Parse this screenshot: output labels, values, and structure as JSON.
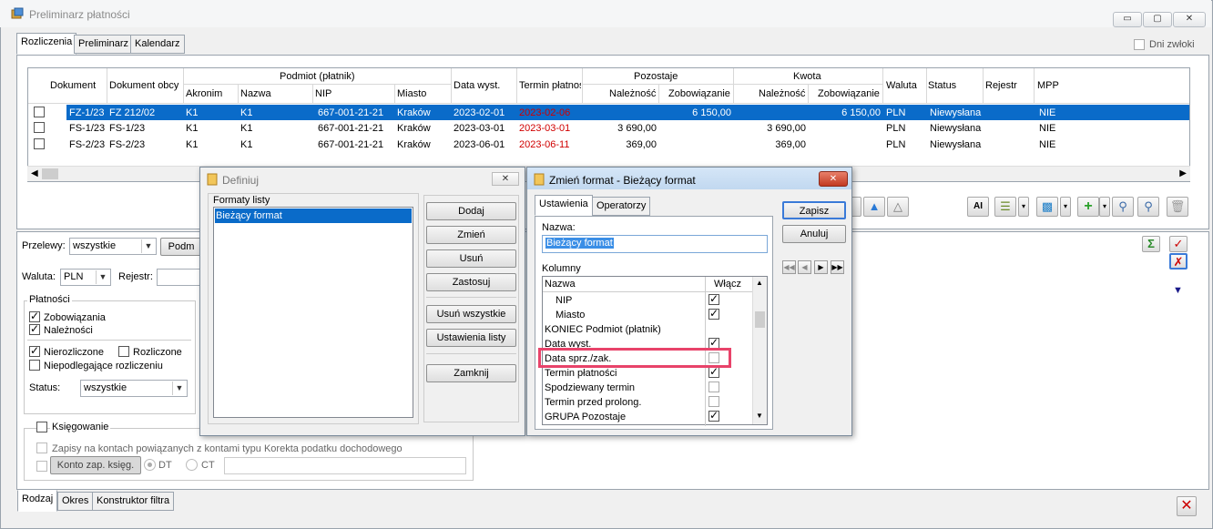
{
  "window": {
    "title": "Preliminarz płatności",
    "controls": {
      "minimize": "▭",
      "maximize": "▢",
      "close": "✕"
    }
  },
  "top_tabs": [
    "Rozliczenia",
    "Preliminarz",
    "Kalendarz"
  ],
  "dni_zwloki": "Dni zwłoki",
  "grid": {
    "headers": {
      "dokument": "Dokument",
      "dokument_obcy": "Dokument obcy",
      "podmiot_group": "Podmiot (płatnik)",
      "akronim": "Akronim",
      "nazwa": "Nazwa",
      "nip": "NIP",
      "miasto": "Miasto",
      "data_wyst": "Data wyst.",
      "termin": "Termin płatnoś",
      "pozostaje_group": "Pozostaje",
      "naleznosc": "Należność",
      "zobowiazanie": "Zobowiązanie",
      "kwota_group": "Kwota",
      "kwota_naleznosc": "Należność",
      "kwota_zobowiazanie": "Zobowiązanie",
      "waluta": "Waluta",
      "status": "Status",
      "rejestr": "Rejestr",
      "mpp": "MPP"
    },
    "rows": [
      {
        "dok": "FZ-1/23",
        "obcy": "FZ 212/02",
        "akr": "K1",
        "naz": "K1",
        "nip": "667-001-21-21",
        "miasto": "Kraków",
        "data": "2023-02-01",
        "termin": "2023-02-06",
        "p_nal": "",
        "p_zob": "6 150,00",
        "k_nal": "",
        "k_zob": "6 150,00",
        "waluta": "PLN",
        "status": "Niewysłana",
        "rejestr": "",
        "mpp": "NIE"
      },
      {
        "dok": "FS-1/23",
        "obcy": "FS-1/23",
        "akr": "K1",
        "naz": "K1",
        "nip": "667-001-21-21",
        "miasto": "Kraków",
        "data": "2023-03-01",
        "termin": "2023-03-01",
        "p_nal": "3 690,00",
        "p_zob": "",
        "k_nal": "3 690,00",
        "k_zob": "",
        "waluta": "PLN",
        "status": "Niewysłana",
        "rejestr": "",
        "mpp": "NIE"
      },
      {
        "dok": "FS-2/23",
        "obcy": "FS-2/23",
        "akr": "K1",
        "naz": "K1",
        "nip": "667-001-21-21",
        "miasto": "Kraków",
        "data": "2023-06-01",
        "termin": "2023-06-11",
        "p_nal": "369,00",
        "p_zob": "",
        "k_nal": "369,00",
        "k_zob": "",
        "waluta": "PLN",
        "status": "Niewysłana",
        "rejestr": "",
        "mpp": "NIE"
      }
    ]
  },
  "filters": {
    "przelewy_label": "Przelewy:",
    "przelewy_value": "wszystkie",
    "podm_button": "Podm",
    "waluta_label": "Waluta:",
    "waluta_value": "PLN",
    "rejestr_label": "Rejestr:",
    "platnosci_title": "Płatności",
    "zobowiazania": "Zobowiązania",
    "naleznosci": "Należności",
    "nierozliczone": "Nierozliczone",
    "rozliczone": "Rozliczone",
    "niepodlegajace": "Niepodlegające rozliczeniu",
    "status_label": "Status:",
    "status_value": "wszystkie",
    "ksiegowanie": "Księgowanie",
    "zapisy": "Zapisy na kontach powiązanych z kontami typu Korekta podatku dochodowego",
    "konto_button": "Konto zap. księg.",
    "dt": "DT",
    "ct": "CT"
  },
  "bottom_tabs": [
    "Rodzaj",
    "Okres",
    "Konstruktor filtra"
  ],
  "definiuj": {
    "title": "Definiuj",
    "formaty_label": "Formaty listy",
    "items": [
      "Bieżący format"
    ],
    "buttons": {
      "dodaj": "Dodaj",
      "zmien": "Zmień",
      "usun": "Usuń",
      "zastosuj": "Zastosuj",
      "usun_wszystkie": "Usuń wszystkie",
      "ustawienia_listy": "Ustawienia listy",
      "zamknij": "Zamknij"
    }
  },
  "zmien_format": {
    "title": "Zmień format - Bieżący format",
    "tabs": [
      "Ustawienia",
      "Operatorzy"
    ],
    "nazwa_label": "Nazwa:",
    "nazwa_value": "Bieżący format",
    "kolumny_label": "Kolumny",
    "col_nazwa": "Nazwa",
    "col_wlacz": "Włącz",
    "columns": [
      {
        "name": "NIP",
        "indent": true,
        "on": true
      },
      {
        "name": "Miasto",
        "indent": true,
        "on": true
      },
      {
        "name": "KONIEC Podmiot (płatnik)",
        "indent": false,
        "on": null
      },
      {
        "name": "Data wyst.",
        "indent": false,
        "on": true
      },
      {
        "name": "Data sprz./zak.",
        "indent": false,
        "on": false
      },
      {
        "name": "Termin płatności",
        "indent": false,
        "on": true
      },
      {
        "name": "Spodziewany termin",
        "indent": false,
        "on": false
      },
      {
        "name": "Termin przed prolong.",
        "indent": false,
        "on": false
      },
      {
        "name": "GRUPA  Pozostaje",
        "indent": false,
        "on": true
      }
    ],
    "buttons": {
      "zapisz": "Zapisz",
      "anuluj": "Anuluj"
    }
  },
  "colors": {
    "selection": "#0a6bc9",
    "overdue": "#d00000",
    "highlight": "#e8436a"
  }
}
